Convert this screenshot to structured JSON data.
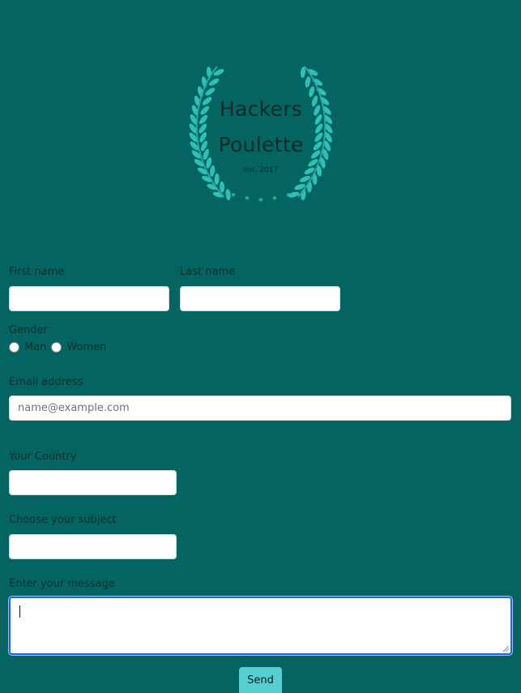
{
  "colors": {
    "background": "#046461",
    "laurel": "#2fbfb5",
    "send_button": "#56cfd3",
    "focus_border": "#1b69d6"
  },
  "logo": {
    "line1": "Hackers",
    "line2": "Poulette",
    "est": "est. 2017",
    "icon": "laurel-wreath-icon"
  },
  "form": {
    "first_name_label": "First name",
    "first_name_value": "",
    "last_name_label": "Last name",
    "last_name_value": "",
    "gender_label": "Gender",
    "gender_options": [
      "Man",
      "Women"
    ],
    "email_label": "Email address",
    "email_placeholder": "name@example.com",
    "email_value": "",
    "country_label": "Your Country",
    "country_value": "",
    "subject_label": "Choose your subject",
    "subject_value": "",
    "message_label": "Enter your message",
    "message_value": "",
    "send_label": "Send"
  }
}
